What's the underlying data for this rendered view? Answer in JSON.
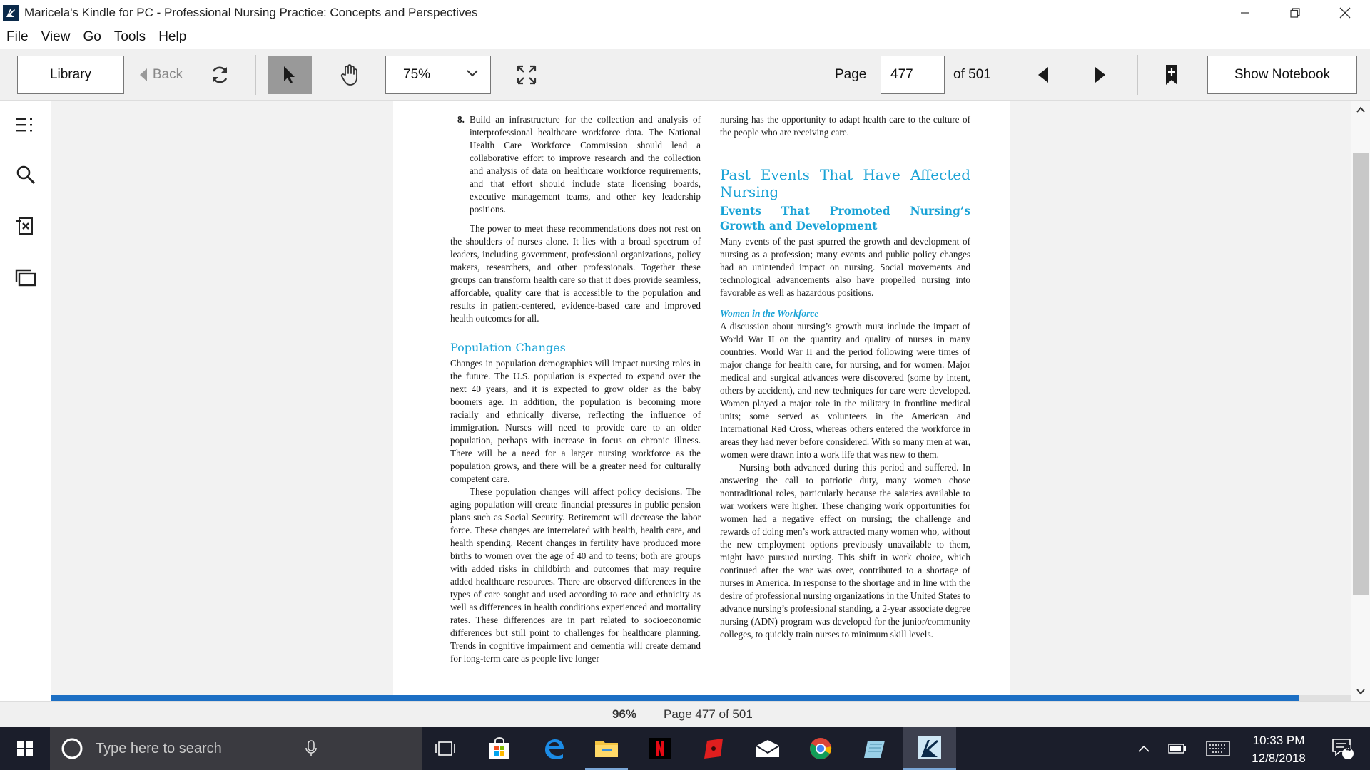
{
  "window": {
    "title": "Maricela's Kindle for PC - Professional Nursing Practice: Concepts and Perspectives"
  },
  "menu": [
    "File",
    "View",
    "Go",
    "Tools",
    "Help"
  ],
  "toolbar": {
    "library": "Library",
    "back": "Back",
    "zoom": "75%",
    "page_label": "Page",
    "page_value": "477",
    "page_of": "of 501",
    "show_notebook": "Show Notebook"
  },
  "book": {
    "left": {
      "item_number": "8.",
      "item_text": "Build an infrastructure for the collection and analysis of interprofessional healthcare workforce data. The National Health Care Workforce Commission should lead a collaborative effort to improve research and the collection and analysis of data on healthcare workforce requirements, and that effort should include state licensing boards, executive management teams, and other key leadership positions.",
      "p1": "The power to meet these recommendations does not rest on the shoulders of nurses alone. It lies with a broad spectrum of leaders, including government, professional organizations, policy makers, researchers, and other professionals. Together these groups can transform health care so that it does provide seamless, affordable, quality care that is accessible to the population and results in patient-centered, evidence-based care and improved health outcomes for all.",
      "heading": "Population Changes",
      "p2": "Changes in population demographics will impact nursing roles in the future. The U.S. population is expected to expand over the next 40 years, and it is expected to grow older as the baby boomers age. In addition, the population is becoming more racially and ethnically diverse, reflecting the influence of immigration. Nurses will need to provide care to an older population, perhaps with increase in focus on chronic illness. There will be a need for a larger nursing workforce as the population grows, and there will be a greater need for culturally competent care.",
      "p3": "These population changes will affect policy decisions. The aging population will create financial pressures in public pension plans such as Social Security. Retirement will decrease the labor force. These changes are interrelated with health, health care, and health spending. Recent changes in fertility have produced more births to women over the age of 40 and to teens; both are groups with added risks in childbirth and outcomes that may require added healthcare resources. There are observed differences in the types of care sought and used according to race and ethnicity as well as differences in health conditions experienced and mortality rates. These differences are in part related to socioeconomic differences but still point to challenges for healthcare planning. Trends in cognitive impairment and dementia will create demand for long-term care as people live longer"
    },
    "right": {
      "p0": "nursing has the opportunity to adapt health care to the culture of the people who are receiving care.",
      "heading1": "Past Events That Have Affected Nursing",
      "heading2": "Events That Promoted Nursing’s Growth and Development",
      "p1": "Many events of the past spurred the growth and development of nursing as a profession; many events and public policy changes had an unintended impact on nursing. Social movements and technological advancements also have propelled nursing into favorable as well as hazardous positions.",
      "heading3": "Women in the Workforce",
      "p2": "A discussion about nursing’s growth must include the impact of World War II on the quantity and quality of nurses in many countries. World War II and the period following were times of major change for health care, for nursing, and for women. Major medical and surgical advances were discovered (some by intent, others by accident), and new techniques for care were developed. Women played a major role in the military in frontline medical units; some served as volunteers in the American and International Red Cross, whereas others entered the workforce in areas they had never before considered. With so many men at war, women were drawn into a work life that was new to them.",
      "p3": "Nursing both advanced during this period and suffered. In answering the call to patriotic duty, many women chose nontraditional roles, particularly because the salaries available to war workers were higher. These changing work opportunities for women had a negative effect on nursing; the challenge and rewards of doing men’s work attracted many women who, without the new employment options previously unavailable to them, might have pursued nursing. This shift in work choice, which continued after the war was over, contributed to a shortage of nurses in America. In response to the shortage and in line with the desire of professional nursing organizations in the United States to advance nursing’s professional standing, a 2-year associate degree nursing (ADN) program was developed for the junior/community colleges, to quickly train nurses to minimum skill levels."
    }
  },
  "status": {
    "percent": "96%",
    "page_text": "Page 477 of 501",
    "progress_fraction": 0.96
  },
  "taskbar": {
    "search_placeholder": "Type here to search",
    "time": "10:33 PM",
    "date": "12/8/2018",
    "notification_count": "4"
  },
  "colors": {
    "heading": "#1ba3d6",
    "progress": "#1c6fc4",
    "taskbar": "#1b1e2b"
  }
}
